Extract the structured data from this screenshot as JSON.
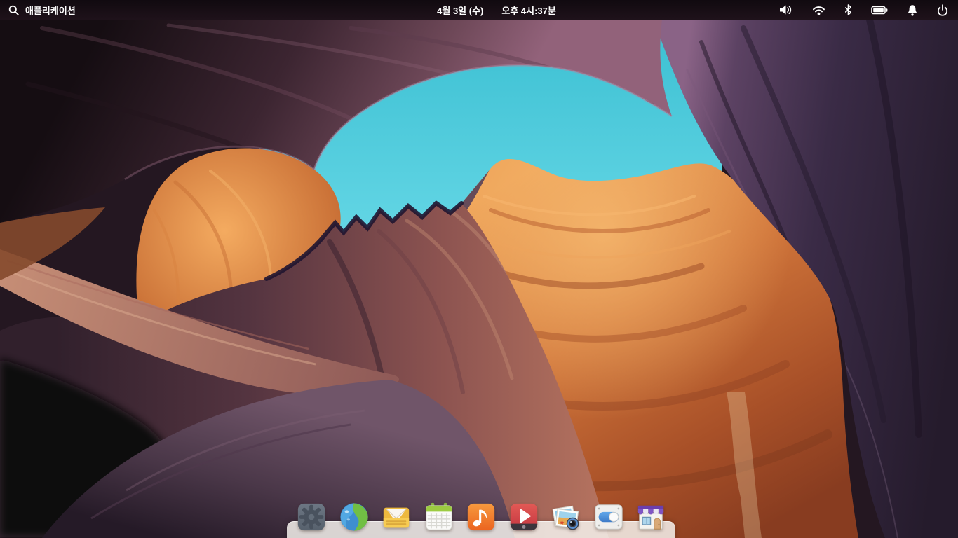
{
  "topbar": {
    "app_menu_label": "애플리케이션",
    "date": "4월 3일 (수)",
    "time": "오후 4시:37분",
    "tray_icons": [
      "volume-icon",
      "wifi-icon",
      "bluetooth-icon",
      "battery-icon",
      "notifications-bell-icon",
      "power-icon"
    ]
  },
  "dock": {
    "items": [
      "system-settings",
      "web-browser",
      "mail",
      "calendar",
      "music",
      "videos",
      "photos",
      "switchboard-settings",
      "appcenter"
    ]
  },
  "wallpaper": {
    "subject": "slot-canyon-rocks-and-sky",
    "colors": {
      "sky_teal": "#4fc9da",
      "orange_rock": "#d0753a",
      "purple_arch": "#5e3f50",
      "dark_wall": "#3a2b46",
      "plum_dune": "#4a3748",
      "shadow": "#0d080d"
    }
  }
}
